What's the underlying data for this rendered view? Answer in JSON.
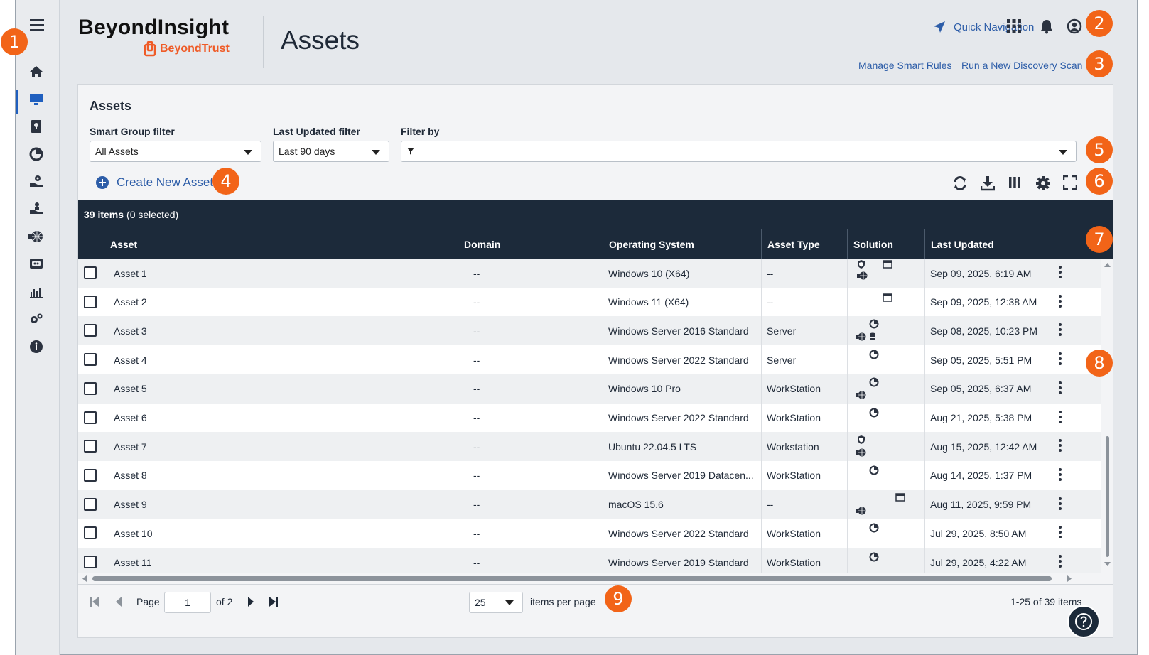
{
  "header": {
    "brand_title": "BeyondInsight",
    "brand_sub": "BeyondTrust",
    "page_title": "Assets",
    "quick_nav": "Quick Navigation",
    "links": [
      "Manage Smart Rules",
      "Run a New Discovery Scan"
    ]
  },
  "sidebar": {
    "items": [
      "home-icon",
      "monitor-icon",
      "book-icon",
      "pie-icon",
      "hand-gear-icon",
      "hand-person-icon",
      "globe-icon",
      "card-icon",
      "analytics-icon",
      "gears-icon",
      "info-icon"
    ]
  },
  "panel": {
    "title": "Assets",
    "filters": {
      "smart_group_label": "Smart Group filter",
      "smart_group_value": "All Assets",
      "last_updated_label": "Last Updated filter",
      "last_updated_value": "Last 90 days",
      "filter_by_label": "Filter by"
    },
    "create_label": "Create New Asset",
    "count_bold": "39 items",
    "count_rest": "(0 selected)"
  },
  "table": {
    "columns": [
      "Asset",
      "Domain",
      "Operating System",
      "Asset Type",
      "Solution",
      "Last Updated"
    ],
    "rows": [
      {
        "asset": "Asset 1",
        "domain": "--",
        "os": "Windows 10 (X64)",
        "type": "--",
        "updated": "Sep 09, 2025, 6:19 AM"
      },
      {
        "asset": "Asset 2",
        "domain": "--",
        "os": "Windows 11 (X64)",
        "type": "--",
        "updated": "Sep 09, 2025, 12:38 AM"
      },
      {
        "asset": "Asset 3",
        "domain": "--",
        "os": "Windows Server 2016 Standard",
        "type": "Server",
        "updated": "Sep 08, 2025, 10:23 PM"
      },
      {
        "asset": "Asset 4",
        "domain": "--",
        "os": "Windows Server 2022 Standard",
        "type": "Server",
        "updated": "Sep 05, 2025, 5:51 PM"
      },
      {
        "asset": "Asset 5",
        "domain": "--",
        "os": "Windows 10 Pro",
        "type": "WorkStation",
        "updated": "Sep 05, 2025, 6:37 AM"
      },
      {
        "asset": "Asset 6",
        "domain": "--",
        "os": "Windows Server 2022 Standard",
        "type": "WorkStation",
        "updated": "Aug 21, 2025, 5:38 PM"
      },
      {
        "asset": "Asset 7",
        "domain": "--",
        "os": "Ubuntu 22.04.5 LTS",
        "type": "Workstation",
        "updated": "Aug 15, 2025, 12:42 AM"
      },
      {
        "asset": "Asset 8",
        "domain": "--",
        "os": "Windows Server 2019 Datacen...",
        "type": "WorkStation",
        "updated": "Aug 14, 2025, 1:37 PM"
      },
      {
        "asset": "Asset 9",
        "domain": "--",
        "os": "macOS 15.6",
        "type": "--",
        "updated": "Aug 11, 2025, 9:59 PM"
      },
      {
        "asset": "Asset 10",
        "domain": "--",
        "os": "Windows Server 2022 Standard",
        "type": "WorkStation",
        "updated": "Jul 29, 2025, 8:50 AM"
      },
      {
        "asset": "Asset 11",
        "domain": "--",
        "os": "Windows Server 2019 Standard",
        "type": "WorkStation",
        "updated": "Jul 29, 2025, 4:22 AM"
      }
    ]
  },
  "pager": {
    "page_label": "Page",
    "page_value": "1",
    "of_label": "of 2",
    "per_page_value": "25",
    "per_page_label": "items per page",
    "range": "1-25 of 39 items"
  },
  "badges": [
    "1",
    "2",
    "3",
    "4",
    "5",
    "6",
    "7",
    "8",
    "9"
  ],
  "colors": {
    "accent": "#f26418",
    "link": "#2d5da8",
    "header_dark": "#1c2a3a"
  }
}
